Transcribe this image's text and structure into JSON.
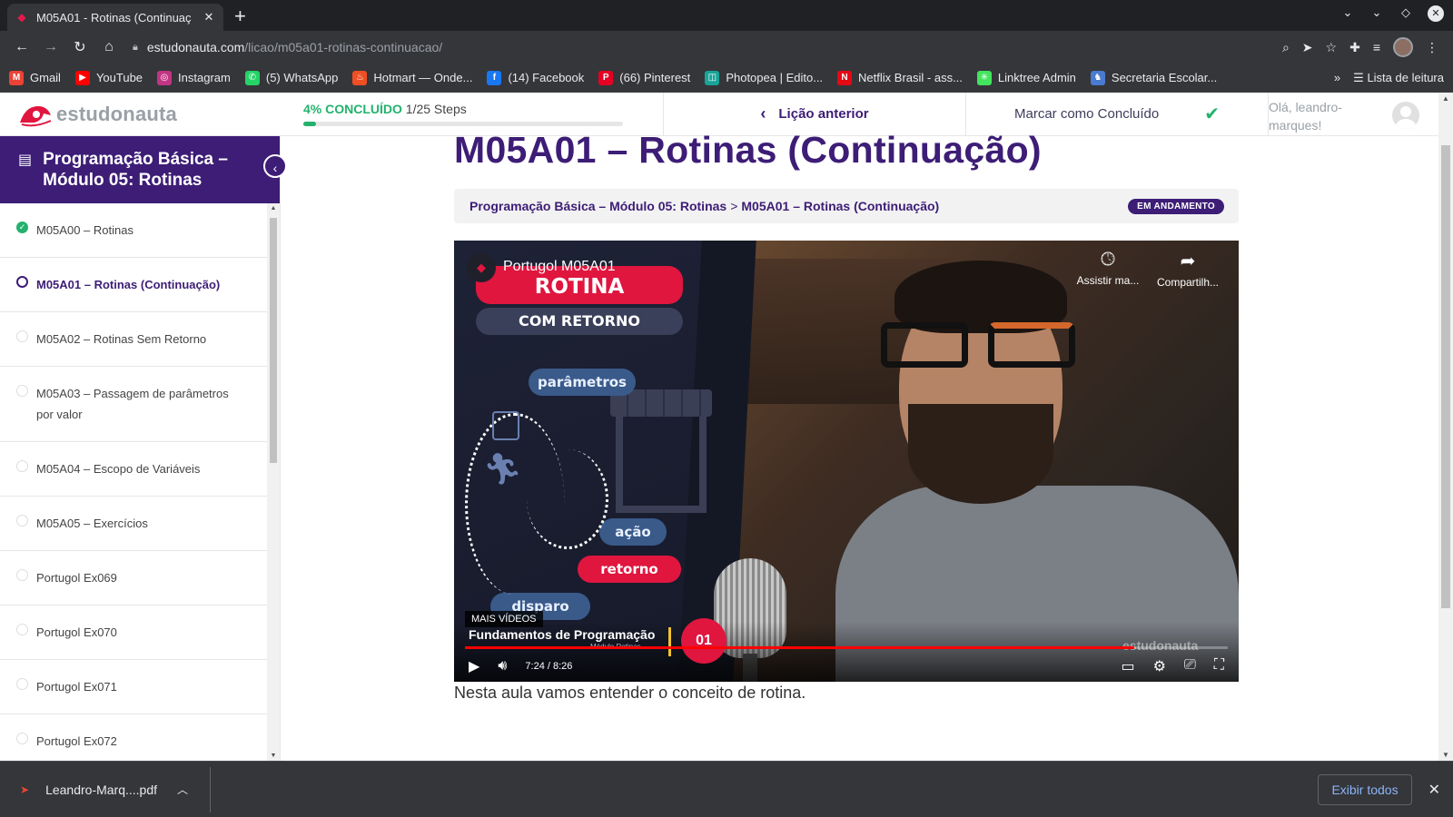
{
  "browser": {
    "tab_title": "M05A01 - Rotinas (Continuaç",
    "url_domain": "estudonauta.com",
    "url_path": "/licao/m05a01-rotinas-continuacao/",
    "bookmarks": [
      {
        "label": "Gmail",
        "color": "#ea4335",
        "glyph": "M"
      },
      {
        "label": "YouTube",
        "color": "#ff0000",
        "glyph": "▶"
      },
      {
        "label": "Instagram",
        "color": "#c13584",
        "glyph": "◎"
      },
      {
        "label": "(5) WhatsApp",
        "color": "#25d366",
        "glyph": "✆"
      },
      {
        "label": "Hotmart — Onde...",
        "color": "#f04e23",
        "glyph": "♨"
      },
      {
        "label": "(14) Facebook",
        "color": "#1877f2",
        "glyph": "f"
      },
      {
        "label": "(66) Pinterest",
        "color": "#e60023",
        "glyph": "P"
      },
      {
        "label": "Photopea | Edito...",
        "color": "#18a497",
        "glyph": "◫"
      },
      {
        "label": "Netflix Brasil - ass...",
        "color": "#e50914",
        "glyph": "N"
      },
      {
        "label": "Linktree Admin",
        "color": "#43e55e",
        "glyph": "✳"
      },
      {
        "label": "Secretaria Escolar...",
        "color": "#4a7bd0",
        "glyph": "♞"
      }
    ],
    "reading_list": "Lista de leitura"
  },
  "header": {
    "logo_text": "estudonauta",
    "progress_percent_label": "4% CONCLUÍDO",
    "progress_steps": "1/25 Steps",
    "progress_fraction": 0.04,
    "prev_lesson": "Lição anterior",
    "mark_complete": "Marcar como Concluído",
    "greeting": "Olá, leandro-marques!"
  },
  "sidebar": {
    "course_title": "Programação Básica – Módulo 05: Rotinas",
    "items": [
      {
        "label": "M05A00 – Rotinas",
        "state": "done"
      },
      {
        "label": "M05A01 – Rotinas (Continuação)",
        "state": "current"
      },
      {
        "label": "M05A02 – Rotinas Sem Retorno",
        "state": "todo"
      },
      {
        "label": "M05A03 – Passagem de parâmetros por valor",
        "state": "todo"
      },
      {
        "label": "M05A04 – Escopo de Variáveis",
        "state": "todo"
      },
      {
        "label": "M05A05 – Exercícios",
        "state": "todo"
      },
      {
        "label": "Portugol Ex069",
        "state": "todo"
      },
      {
        "label": "Portugol Ex070",
        "state": "todo"
      },
      {
        "label": "Portugol Ex071",
        "state": "todo"
      },
      {
        "label": "Portugol Ex072",
        "state": "todo"
      }
    ]
  },
  "main": {
    "title": "M05A01 – Rotinas (Continuação)",
    "breadcrumb": {
      "course": "Programação Básica – Módulo 05: Rotinas",
      "separator": ">",
      "lesson": "M05A01 – Rotinas (Continuação)"
    },
    "status_badge": "EM ANDAMENTO",
    "description": "Nesta aula vamos entender o conceito de rotina."
  },
  "video": {
    "title": "Portugol M05A01",
    "watch_later": "Assistir ma...",
    "share": "Compartilh...",
    "thumb_text": {
      "rotina": "ROTINA",
      "com_retorno": "COM RETORNO",
      "parametros": "parâmetros",
      "acao": "ação",
      "retorno": "retorno",
      "disparo": "disparo",
      "fundamentos": "Fundamentos de Programação",
      "modulo": "Módulo Rotinas",
      "episode": "01",
      "watermark": "estudonauta"
    },
    "more_videos": "MAIS VÍDEOS",
    "time": "7:24 / 8:26",
    "progress_fraction": 0.877
  },
  "downloads": {
    "file_name": "Leandro-Marq....pdf",
    "show_all": "Exibir todos"
  }
}
